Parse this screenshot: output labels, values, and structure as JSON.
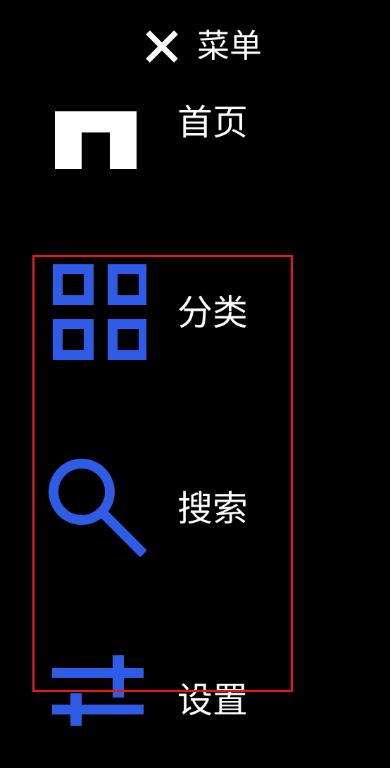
{
  "header": {
    "close_icon": "close-icon",
    "title": "菜单"
  },
  "menu": {
    "items": [
      {
        "id": "home",
        "label": "首页",
        "icon": "home-icon",
        "icon_color": "#ffffff"
      },
      {
        "id": "categories",
        "label": "分类",
        "icon": "grid-icon",
        "icon_color": "#2f5ce6"
      },
      {
        "id": "search",
        "label": "搜索",
        "icon": "search-icon",
        "icon_color": "#2f5ce6"
      },
      {
        "id": "settings",
        "label": "设置",
        "icon": "settings-icon",
        "icon_color": "#2f5ce6"
      }
    ]
  },
  "colors": {
    "background": "#000000",
    "text": "#ffffff",
    "accent": "#2f5ce6",
    "highlight_border": "#e81717"
  }
}
